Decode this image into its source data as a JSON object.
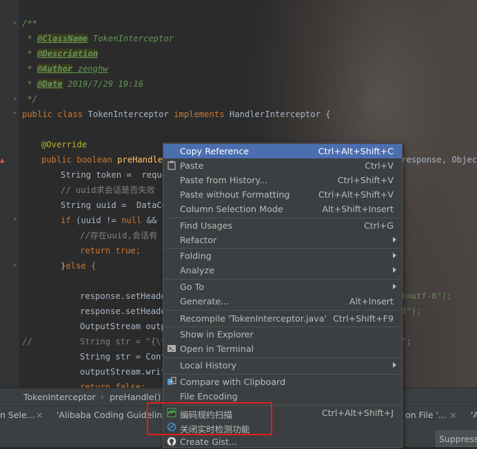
{
  "code": {
    "doc_open": "/**",
    "classname_tag": "@ClassName",
    "classname_val": " TokenInterceptor",
    "description_tag": "@Description",
    "author_tag": "@Author",
    "author_val": " zenghw",
    "date_tag": "@Date",
    "date_val": " 2019/7/29 19:16",
    "doc_close": " */",
    "l7_public": "public ",
    "l7_class": "class ",
    "l7_name": "TokenInterceptor ",
    "l7_impl": "implements ",
    "l7_iface": "HandlerInterceptor {",
    "override": "@Override",
    "l9_kw": "public boolean ",
    "l9_fn": "preHandle(",
    "l9_tail": "response, Object h",
    "l10": "String token =  reque",
    "l11": "// uuid求会话是否失效",
    "l12": "String uuid =  DataCe",
    "l13_if": "if ",
    "l13_rest": "(uuid != ",
    "l13_null": "null",
    "l13_tail": " && !",
    "l14": "//存在uuid,会话有",
    "l15": "return true;",
    "l16_a": "}",
    "l16_b": "else {",
    "l17": "response.setHeade",
    "l17_tail": "t=utf-8\");",
    "l18": "response.setHeade",
    "l18_tail": "8\");",
    "l19": "OutputStream outp",
    "l20_slash": "//",
    "l20": "String str = \"{\\\"",
    "l20_tail": "\";",
    "l21": "String str = Conf",
    "l22": "outputStream.writ",
    "l23": "return false;"
  },
  "breadcrumb": {
    "class": "TokenInterceptor",
    "sep": "›",
    "method": "preHandle()"
  },
  "tabs": [
    "n Sele...",
    "×",
    "'Alibaba Coding Guidelines",
    "on File '...",
    "×",
    "'A"
  ],
  "suppress_label": "Suppress",
  "menu": {
    "items": [
      {
        "label": "Copy Reference",
        "shortcut": "Ctrl+Alt+Shift+C"
      },
      {
        "label": "Paste",
        "shortcut": "Ctrl+V"
      },
      {
        "label": "Paste from History...",
        "shortcut": "Ctrl+Shift+V"
      },
      {
        "label": "Paste without Formatting",
        "shortcut": "Ctrl+Alt+Shift+V"
      },
      {
        "label": "Column Selection Mode",
        "shortcut": "Alt+Shift+Insert"
      },
      {
        "label": "Find Usages",
        "shortcut": "Ctrl+G"
      },
      {
        "label": "Refactor",
        "shortcut": ""
      },
      {
        "label": "Folding",
        "shortcut": ""
      },
      {
        "label": "Analyze",
        "shortcut": ""
      },
      {
        "label": "Go To",
        "shortcut": ""
      },
      {
        "label": "Generate...",
        "shortcut": "Alt+Insert"
      },
      {
        "label": "Recompile 'TokenInterceptor.java'",
        "shortcut": "Ctrl+Shift+F9"
      },
      {
        "label": "Show in Explorer",
        "shortcut": ""
      },
      {
        "label": "Open in Terminal",
        "shortcut": ""
      },
      {
        "label": "Local History",
        "shortcut": ""
      },
      {
        "label": "Compare with Clipboard",
        "shortcut": ""
      },
      {
        "label": "File Encoding",
        "shortcut": ""
      },
      {
        "label": "编码规约扫描",
        "shortcut": "Ctrl+Alt+Shift+J"
      },
      {
        "label": "关闭实时检测功能",
        "shortcut": ""
      },
      {
        "label": "Create Gist...",
        "shortcut": ""
      }
    ],
    "highlighted": "Copy Reference",
    "icons": {
      "paste": "clipboard-icon",
      "terminal": "terminal-icon",
      "compare": "compare-icon",
      "scan": "scan-chart-icon",
      "disable": "disable-circle-icon",
      "gist": "github-icon"
    }
  },
  "colors": {
    "highlight": "#4b6eaf",
    "menu_bg": "#3c3f41",
    "annotation_box": "#e01e1e"
  }
}
